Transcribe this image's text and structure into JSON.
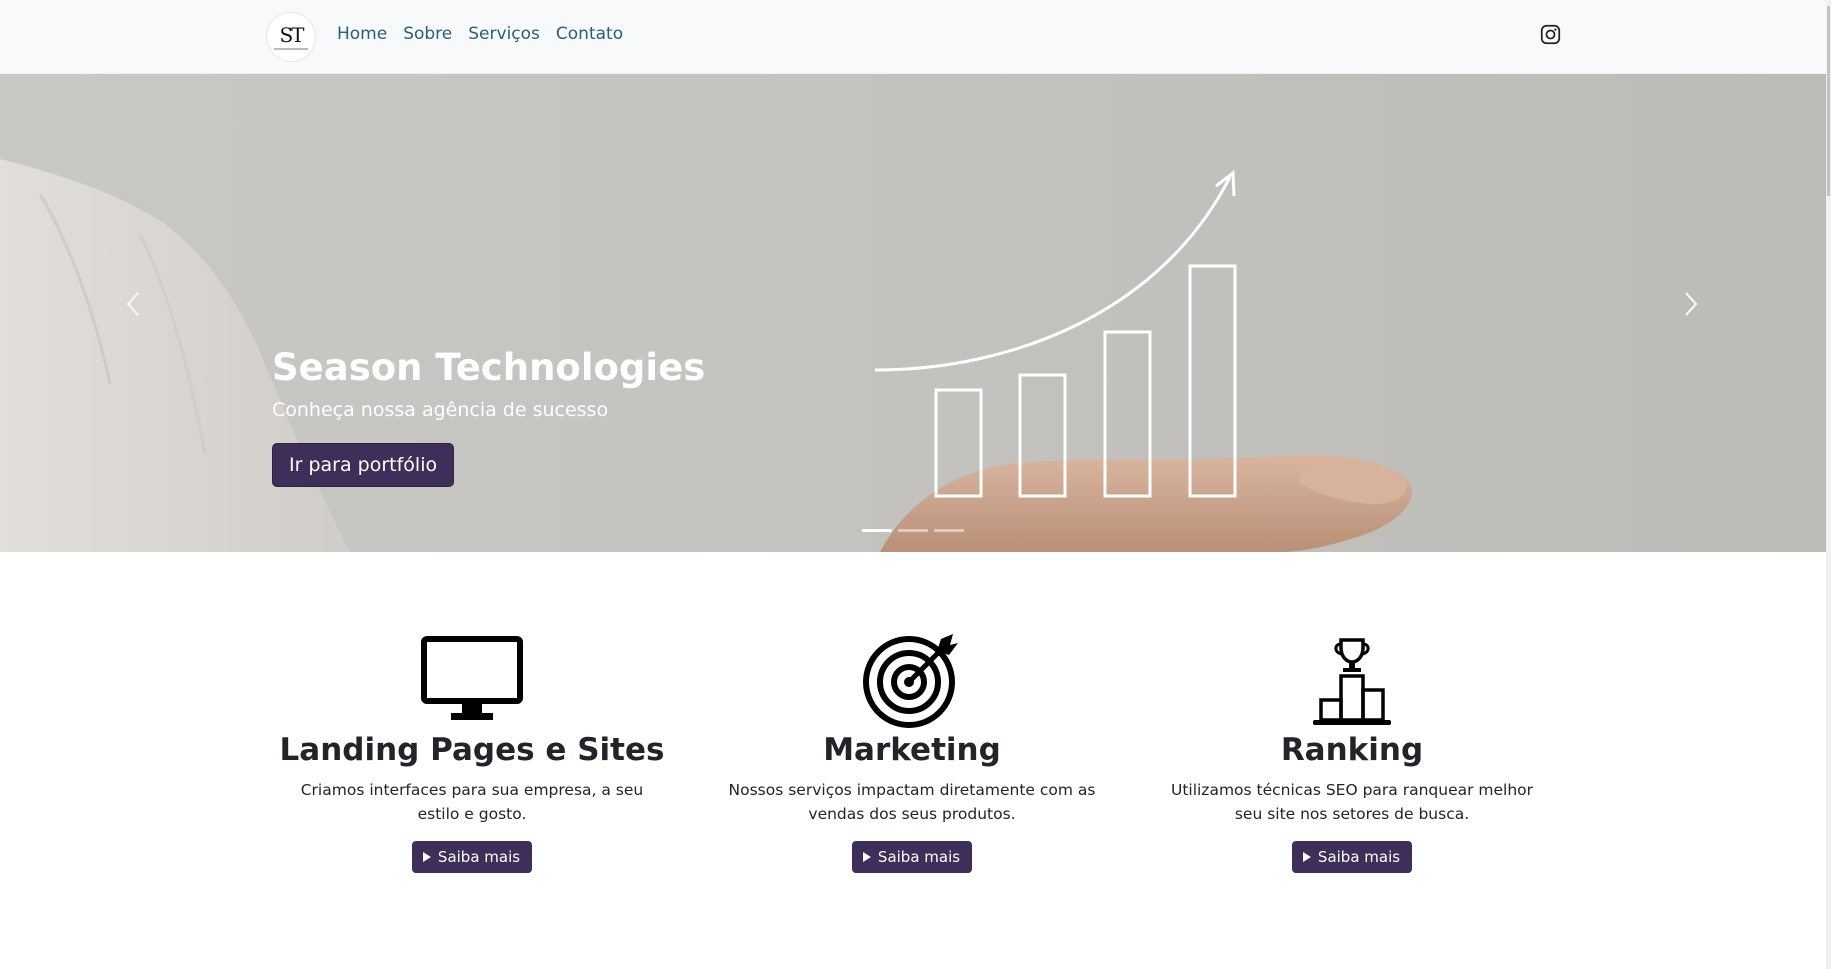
{
  "navbar": {
    "logo_text": "ST",
    "links": [
      {
        "label": "Home"
      },
      {
        "label": "Sobre"
      },
      {
        "label": "Serviços"
      },
      {
        "label": "Contato"
      }
    ],
    "social_icon": "instagram-icon",
    "link_color": "#2a5f7a"
  },
  "hero": {
    "title": "Season Technologies",
    "subtitle": "Conheça nossa agência de sucesso",
    "button_label": "Ir para portfólio",
    "prev_icon": "chevron-left-icon",
    "next_icon": "chevron-right-icon",
    "slide_count": 3,
    "active_slide": 1
  },
  "services": [
    {
      "icon": "monitor-icon",
      "title": "Landing Pages e Sites",
      "description": "Criamos interfaces para sua empresa, a seu estilo e gosto.",
      "button_label": "Saiba mais"
    },
    {
      "icon": "target-icon",
      "title": "Marketing",
      "description": "Nossos serviços impactam diretamente com as vendas dos seus produtos.",
      "button_label": "Saiba mais"
    },
    {
      "icon": "trophy-ranking-icon",
      "title": "Ranking",
      "description": "Utilizamos técnicas SEO para ranquear melhor seu site nos setores de busca.",
      "button_label": "Saiba mais"
    }
  ],
  "colors": {
    "primary": "#3d2e5a",
    "navbar_bg": "#f8f9fa",
    "hero_bg": "#c4c3bf"
  }
}
